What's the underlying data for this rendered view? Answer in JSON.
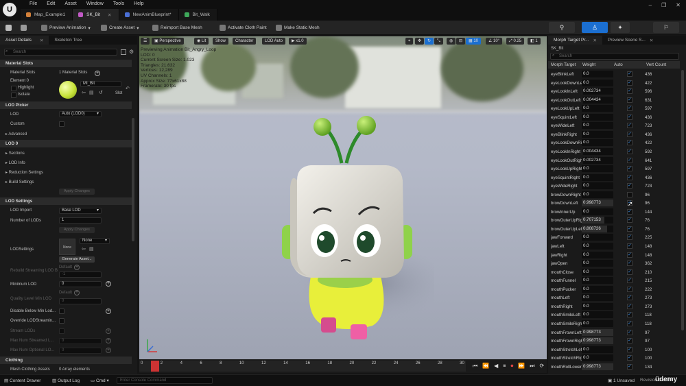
{
  "menu": [
    "File",
    "Edit",
    "Asset",
    "Window",
    "Tools",
    "Help"
  ],
  "tabs": [
    {
      "label": "Map_Example1",
      "color": "#d4813a"
    },
    {
      "label": "SK_Bit",
      "color": "#c25ac6"
    },
    {
      "label": "NewAnimBlueprint*",
      "color": "#4a6fd4"
    },
    {
      "label": "Bit_Walk",
      "color": "#3ea85a"
    }
  ],
  "toolbar": {
    "preview_animation": "Preview Animation",
    "create_asset": "Create Asset",
    "reimport": "Reimport Base Mesh",
    "cloth_paint": "Activate Cloth Paint",
    "static_mesh": "Make Static Mesh"
  },
  "left": {
    "tabs": [
      "Asset Details",
      "Skeleton Tree"
    ],
    "search_placeholder": "Search",
    "material_slots_header": "Material Slots",
    "material_slots_label": "Material Slots",
    "material_slots_value": "1 Material Slots",
    "element0": "Element 0",
    "highlight": "Highlight",
    "isolate": "Isolate",
    "material_name": "MI_Bit",
    "slot": "Slot",
    "lod_picker_header": "LOD Picker",
    "lod_label": "LOD",
    "lod_value": "Auto (LOD0)",
    "custom": "Custom",
    "advanced": "Advanced",
    "lod0_header": "LOD 0",
    "sections": "Sections",
    "lod_info": "LOD Info",
    "reduction": "Reduction Settings",
    "build": "Build Settings",
    "apply_changes": "Apply Changes",
    "lod_settings_header": "LOD Settings",
    "lod_import": "LOD Import",
    "lod_import_value": "Base LOD",
    "num_lods": "Number of LODs",
    "num_lods_value": "1",
    "apply_changes2": "Apply Changes",
    "lodsettings": "LODSettings",
    "none_label": "None",
    "none_value": "None",
    "generate": "Generate Asset...",
    "rebuild_streaming": "Rebuild Streaming LOD B",
    "default": "Default",
    "minimum_lod": "Minimum LOD",
    "minimum_lod_value": "0",
    "default2": "Default",
    "quality_level": "Quality Level Min LOD",
    "quality_value": "0",
    "disable_below": "Disable Below Min Lod...",
    "override_streaming": "Override LODStreamin...",
    "stream_lods": "Stream LODs",
    "max_streamed": "Max Num Streamed L...",
    "max_optional": "Max Num Optional LO...",
    "clothing_header": "Clothing",
    "mesh_clothing": "Mesh Clothing Assets",
    "mesh_clothing_value": "0 Array elements",
    "neg1": "-1"
  },
  "viewport": {
    "perspective": "Perspective",
    "lit": "Lit",
    "show": "Show",
    "character": "Character",
    "lod_auto": "LOD Auto",
    "speed": "x1.0",
    "grid": "10",
    "angle": "10°",
    "scale": "0.25",
    "cam": "1",
    "info": [
      "Previewing Animation Bit_Angry_Loop",
      "LOD: 0",
      "Current Screen Size: 1.023",
      "Triangles: 21,632",
      "Vertices: 12,289",
      "UV Channels: 1",
      "Approx Size: 77x61x88",
      "Framerate: 30 fps"
    ]
  },
  "timeline_ticks": [
    "0",
    "2",
    "4",
    "6",
    "8",
    "10",
    "12",
    "14",
    "16",
    "18",
    "20",
    "22",
    "24",
    "26",
    "28",
    "30"
  ],
  "right": {
    "tabs": [
      "Morph Target Pr...",
      "Preview Scene S..."
    ],
    "asset": "SK_Bit",
    "search_placeholder": "Search",
    "headers": [
      "Morph Target",
      "Weight",
      "Auto",
      "Vert Count"
    ],
    "rows": [
      {
        "name": "eyeBlinkLeft",
        "weight": "0.0",
        "w": 0,
        "auto": true,
        "count": "436"
      },
      {
        "name": "eyeLookDownLeft",
        "weight": "0.0",
        "w": 0,
        "auto": true,
        "count": "422"
      },
      {
        "name": "eyeLookInLeft",
        "weight": "0.002734",
        "w": 0.002734,
        "auto": true,
        "count": "596"
      },
      {
        "name": "eyeLookOutLeft",
        "weight": "0.004434",
        "w": 0.004434,
        "auto": true,
        "count": "631"
      },
      {
        "name": "eyeLookUpLeft",
        "weight": "0.0",
        "w": 0,
        "auto": true,
        "count": "597"
      },
      {
        "name": "eyeSquintLeft",
        "weight": "0.0",
        "w": 0,
        "auto": true,
        "count": "436"
      },
      {
        "name": "eyeWideLeft",
        "weight": "0.0",
        "w": 0,
        "auto": true,
        "count": "723"
      },
      {
        "name": "eyeBlinkRight",
        "weight": "0.0",
        "w": 0,
        "auto": true,
        "count": "436"
      },
      {
        "name": "eyeLookDownRight",
        "weight": "0.0",
        "w": 0,
        "auto": true,
        "count": "422"
      },
      {
        "name": "eyeLookInRight",
        "weight": "0.004434",
        "w": 0.004434,
        "auto": true,
        "count": "592"
      },
      {
        "name": "eyeLookOutRight",
        "weight": "0.002734",
        "w": 0.002734,
        "auto": true,
        "count": "641"
      },
      {
        "name": "eyeLookUpRight",
        "weight": "0.0",
        "w": 0,
        "auto": true,
        "count": "597"
      },
      {
        "name": "eyeSquintRight",
        "weight": "0.0",
        "w": 0,
        "auto": true,
        "count": "436"
      },
      {
        "name": "eyeWideRight",
        "weight": "0.0",
        "w": 0,
        "auto": true,
        "count": "723"
      },
      {
        "name": "browDownRight",
        "weight": "0.0",
        "w": 0,
        "auto": false,
        "count": "96"
      },
      {
        "name": "browDownLeft",
        "weight": "0.998773",
        "w": 0.998773,
        "auto": true,
        "count": "96"
      },
      {
        "name": "browInnerUp",
        "weight": "0.0",
        "w": 0,
        "auto": true,
        "count": "144"
      },
      {
        "name": "browOuterUpRight",
        "weight": "0.707153",
        "w": 0.707153,
        "auto": true,
        "count": "76"
      },
      {
        "name": "browOuterUpLeft",
        "weight": "0.808726",
        "w": 0.808726,
        "auto": true,
        "count": "76"
      },
      {
        "name": "jawForward",
        "weight": "0.0",
        "w": 0,
        "auto": true,
        "count": "225"
      },
      {
        "name": "jawLeft",
        "weight": "0.0",
        "w": 0,
        "auto": true,
        "count": "148"
      },
      {
        "name": "jawRight",
        "weight": "0.0",
        "w": 0,
        "auto": true,
        "count": "148"
      },
      {
        "name": "jawOpen",
        "weight": "0.0",
        "w": 0,
        "auto": true,
        "count": "362"
      },
      {
        "name": "mouthClose",
        "weight": "0.0",
        "w": 0,
        "auto": true,
        "count": "210"
      },
      {
        "name": "mouthFunnel",
        "weight": "0.0",
        "w": 0,
        "auto": true,
        "count": "215"
      },
      {
        "name": "mouthPucker",
        "weight": "0.0",
        "w": 0,
        "auto": true,
        "count": "222"
      },
      {
        "name": "mouthLeft",
        "weight": "0.0",
        "w": 0,
        "auto": true,
        "count": "273"
      },
      {
        "name": "mouthRight",
        "weight": "0.0",
        "w": 0,
        "auto": true,
        "count": "273"
      },
      {
        "name": "mouthSmileLeft",
        "weight": "0.0",
        "w": 0,
        "auto": true,
        "count": "118"
      },
      {
        "name": "mouthSmileRight",
        "weight": "0.0",
        "w": 0,
        "auto": true,
        "count": "118"
      },
      {
        "name": "mouthFrownLeft",
        "weight": "0.998773",
        "w": 0.998773,
        "auto": true,
        "count": "97"
      },
      {
        "name": "mouthFrownRight",
        "weight": "0.998773",
        "w": 0.998773,
        "auto": true,
        "count": "97"
      },
      {
        "name": "mouthStretchLeft",
        "weight": "0.0",
        "w": 0,
        "auto": true,
        "count": "100"
      },
      {
        "name": "mouthStretchRight",
        "weight": "0.0",
        "w": 0,
        "auto": true,
        "count": "100"
      },
      {
        "name": "mouthRollLower",
        "weight": "0.998773",
        "w": 0.998773,
        "auto": true,
        "count": "134"
      }
    ]
  },
  "status": {
    "content_drawer": "Content Drawer",
    "output_log": "Output Log",
    "cmd": "Cmd",
    "console_placeholder": "Enter Console Command",
    "unsaved": "1 Unsaved",
    "revision": "Revision Control",
    "watermark": "üdemy"
  },
  "colors": {
    "accent": "#1b6fd1",
    "check": "#3d8de0"
  }
}
